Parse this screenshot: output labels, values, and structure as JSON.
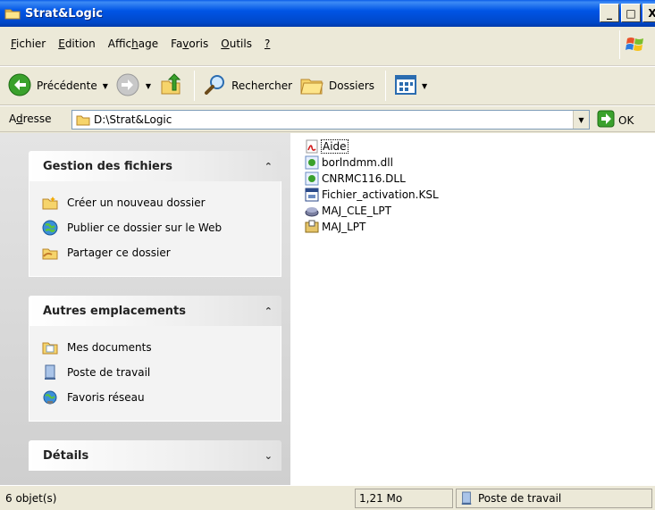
{
  "window": {
    "title": "Strat&Logic",
    "min": "_",
    "max": "□",
    "close": "X"
  },
  "menu": {
    "items": [
      {
        "first": "F",
        "rest": "ichier"
      },
      {
        "first": "E",
        "rest": "dition"
      },
      {
        "pre": "Affic",
        "u": "h",
        "post": "age"
      },
      {
        "pre": "Fa",
        "u": "v",
        "post": "oris"
      },
      {
        "first": "O",
        "rest": "utils"
      },
      {
        "first": "?",
        "rest": ""
      }
    ]
  },
  "toolbar": {
    "back_label": "Précédente",
    "search_label": "Rechercher",
    "folders_label": "Dossiers"
  },
  "address": {
    "label_pre": "A",
    "label_u": "d",
    "label_post": "resse",
    "value": "D:\\Strat&Logic",
    "go_label": "OK"
  },
  "panels": {
    "file_tasks": {
      "title": "Gestion des fichiers",
      "items": [
        "Créer un nouveau dossier",
        "Publier ce dossier sur le Web",
        "Partager ce dossier"
      ]
    },
    "other_places": {
      "title": "Autres emplacements",
      "items": [
        "Mes documents",
        "Poste de travail",
        "Favoris réseau"
      ]
    },
    "details": {
      "title": "Détails"
    }
  },
  "files": [
    {
      "name": "Aide",
      "icon": "pdf-icon"
    },
    {
      "name": "borlndmm.dll",
      "icon": "dll-icon"
    },
    {
      "name": "CNRMC116.DLL",
      "icon": "dll-icon"
    },
    {
      "name": "Fichier_activation.KSL",
      "icon": "ksl-file-icon"
    },
    {
      "name": "MAJ_CLE_LPT",
      "icon": "installer-icon"
    },
    {
      "name": "MAJ_LPT",
      "icon": "installer-box-icon"
    }
  ],
  "status": {
    "count": "6 objet(s)",
    "size": "1,21 Mo",
    "location": "Poste de travail"
  },
  "colors": {
    "titlebar": "#0055e5",
    "pane": "#d4d4d4",
    "chrome": "#ece9d8"
  }
}
